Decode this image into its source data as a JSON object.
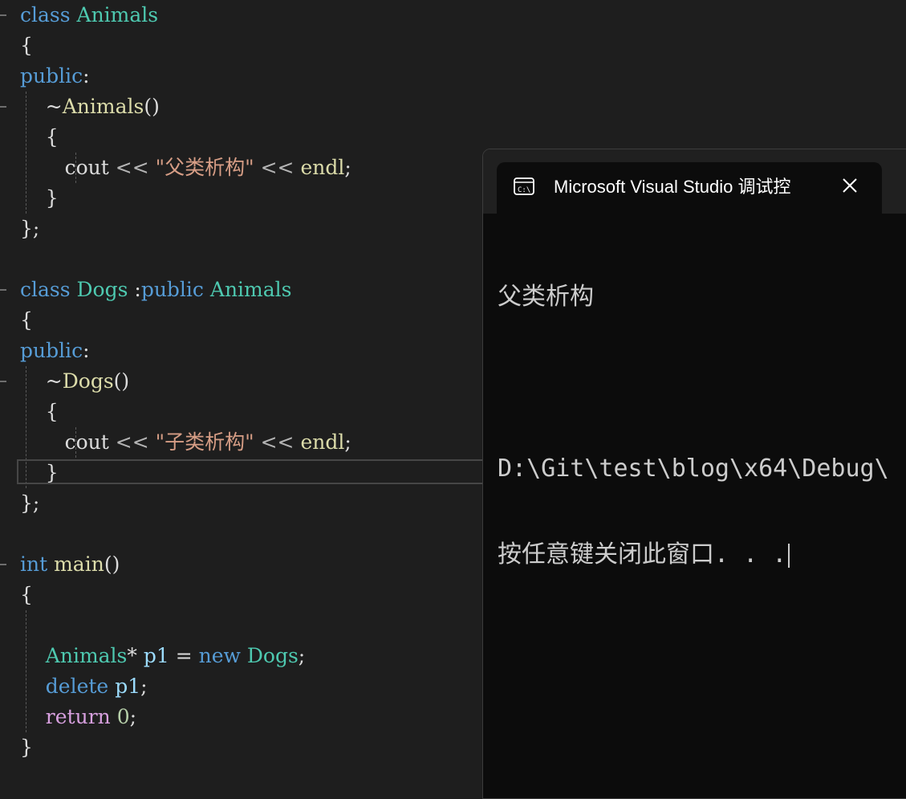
{
  "editor": {
    "lines": [
      [
        {
          "t": "class ",
          "c": "kw"
        },
        {
          "t": "Animals",
          "c": "type"
        }
      ],
      [
        {
          "t": "{",
          "c": "plain"
        }
      ],
      [
        {
          "t": "public",
          "c": "kw"
        },
        {
          "t": ":",
          "c": "plain"
        }
      ],
      [
        {
          "t": "    ~",
          "c": "plain"
        },
        {
          "t": "Animals",
          "c": "fn"
        },
        {
          "t": "()",
          "c": "plain"
        }
      ],
      [
        {
          "t": "    {",
          "c": "plain"
        }
      ],
      [
        {
          "t": "       cout ",
          "c": "plain"
        },
        {
          "t": "<<",
          "c": "punc"
        },
        {
          "t": " \"父类析构\"",
          "c": "str"
        },
        {
          "t": " << ",
          "c": "punc"
        },
        {
          "t": "endl",
          "c": "fn"
        },
        {
          "t": ";",
          "c": "plain"
        }
      ],
      [
        {
          "t": "    }",
          "c": "plain"
        }
      ],
      [
        {
          "t": "};",
          "c": "plain"
        }
      ],
      [],
      [
        {
          "t": "class ",
          "c": "kw"
        },
        {
          "t": "Dogs",
          "c": "type"
        },
        {
          "t": " :",
          "c": "plain"
        },
        {
          "t": "public ",
          "c": "kw"
        },
        {
          "t": "Animals",
          "c": "type"
        }
      ],
      [
        {
          "t": "{",
          "c": "plain"
        }
      ],
      [
        {
          "t": "public",
          "c": "kw"
        },
        {
          "t": ":",
          "c": "plain"
        }
      ],
      [
        {
          "t": "    ~",
          "c": "plain"
        },
        {
          "t": "Dogs",
          "c": "fn"
        },
        {
          "t": "()",
          "c": "plain"
        }
      ],
      [
        {
          "t": "    {",
          "c": "plain"
        }
      ],
      [
        {
          "t": "       cout ",
          "c": "plain"
        },
        {
          "t": "<<",
          "c": "punc"
        },
        {
          "t": " \"子类析构\"",
          "c": "str"
        },
        {
          "t": " << ",
          "c": "punc"
        },
        {
          "t": "endl",
          "c": "fn"
        },
        {
          "t": ";",
          "c": "plain"
        }
      ],
      [
        {
          "t": "    }",
          "c": "plain"
        }
      ],
      [
        {
          "t": "};",
          "c": "plain"
        }
      ],
      [],
      [
        {
          "t": "int ",
          "c": "kw"
        },
        {
          "t": "main",
          "c": "fn"
        },
        {
          "t": "()",
          "c": "plain"
        }
      ],
      [
        {
          "t": "{",
          "c": "plain"
        }
      ],
      [],
      [
        {
          "t": "    ",
          "c": "plain"
        },
        {
          "t": "Animals",
          "c": "type"
        },
        {
          "t": "* ",
          "c": "plain"
        },
        {
          "t": "p1",
          "c": "var"
        },
        {
          "t": " = ",
          "c": "plain"
        },
        {
          "t": "new ",
          "c": "kw"
        },
        {
          "t": "Dogs",
          "c": "type"
        },
        {
          "t": ";",
          "c": "plain"
        }
      ],
      [
        {
          "t": "    ",
          "c": "plain"
        },
        {
          "t": "delete ",
          "c": "kw"
        },
        {
          "t": "p1",
          "c": "var"
        },
        {
          "t": ";",
          "c": "plain"
        }
      ],
      [
        {
          "t": "    ",
          "c": "plain"
        },
        {
          "t": "return ",
          "c": "ctl"
        },
        {
          "t": "0",
          "c": "num"
        },
        {
          "t": ";",
          "c": "plain"
        }
      ],
      [
        {
          "t": "}",
          "c": "plain"
        }
      ]
    ]
  },
  "console": {
    "tab_title": "Microsoft Visual Studio 调试控",
    "icon": "terminal-icon",
    "close_icon": "close-icon",
    "output_line_1": "父类析构",
    "output_line_2": "",
    "output_line_3": "D:\\Git\\test\\blog\\x64\\Debug\\",
    "output_line_4": "按任意键关闭此窗口. . ."
  }
}
